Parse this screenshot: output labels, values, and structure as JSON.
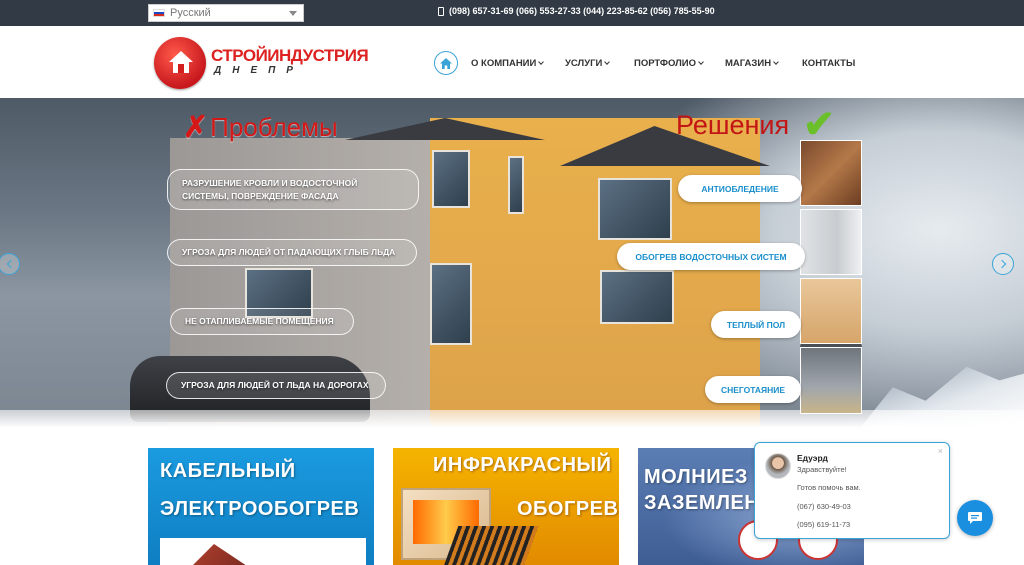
{
  "topbar": {
    "language": "Русский",
    "phones": "(098) 657-31-69 (066) 553-27-33 (044) 223-85-62 (056) 785-55-90"
  },
  "logo": {
    "title": "СТРОЙИНДУСТРИЯ",
    "subtitle": "ДНЕПР"
  },
  "nav": {
    "items": [
      {
        "label": "О КОМПАНИИ",
        "dropdown": true
      },
      {
        "label": "УСЛУГИ",
        "dropdown": true
      },
      {
        "label": "ПОРТФОЛИО",
        "dropdown": true
      },
      {
        "label": "МАГАЗИН",
        "dropdown": true
      },
      {
        "label": "КОНТАКТЫ",
        "dropdown": false
      }
    ]
  },
  "hero": {
    "problems_title": "Проблемы",
    "solutions_title": "Решения",
    "problems": [
      "РАЗРУШЕНИЕ КРОВЛИ И ВОДОСТОЧНОЙ СИСТЕМЫ, ПОВРЕЖДЕНИЕ ФАСАДА",
      "УГРОЗА ДЛЯ ЛЮДЕЙ ОТ ПАДАЮЩИХ ГЛЫБ ЛЬДА",
      "НЕ ОТАПЛИВАЕМЫЕ ПОМЕЩЕНИЯ",
      "УГРОЗА ДЛЯ ЛЮДЕЙ ОТ ЛЬДА НА ДОРОГАХ"
    ],
    "solutions": [
      "АНТИОБЛЕДЕНИЕ",
      "ОБОГРЕВ ВОДОСТОЧНЫХ СИСТЕМ",
      "ТЕПЛЫЙ ПОЛ",
      "СНЕГОТАЯНИЕ"
    ]
  },
  "banners": [
    {
      "line1": "КАБЕЛЬНЫЙ",
      "line2": "ЭЛЕКТРООБОГРЕВ"
    },
    {
      "line1": "ИНФРАКРАСНЫЙ",
      "line2": "ОБОГРЕВ"
    },
    {
      "line1": "МОЛНИЕЗ",
      "line2": "ЗАЗЕМЛЕН"
    }
  ],
  "chat": {
    "name": "Едуэрд",
    "greeting": "Здравствуйте!",
    "offer": "Готов помочь вам.",
    "phone1": "(067) 630-49-03",
    "phone2": "(095) 619-11-73",
    "close": "×"
  },
  "colors": {
    "accent": "#3aa4d8",
    "topbar": "#323b45",
    "brand_red": "#d22222"
  }
}
